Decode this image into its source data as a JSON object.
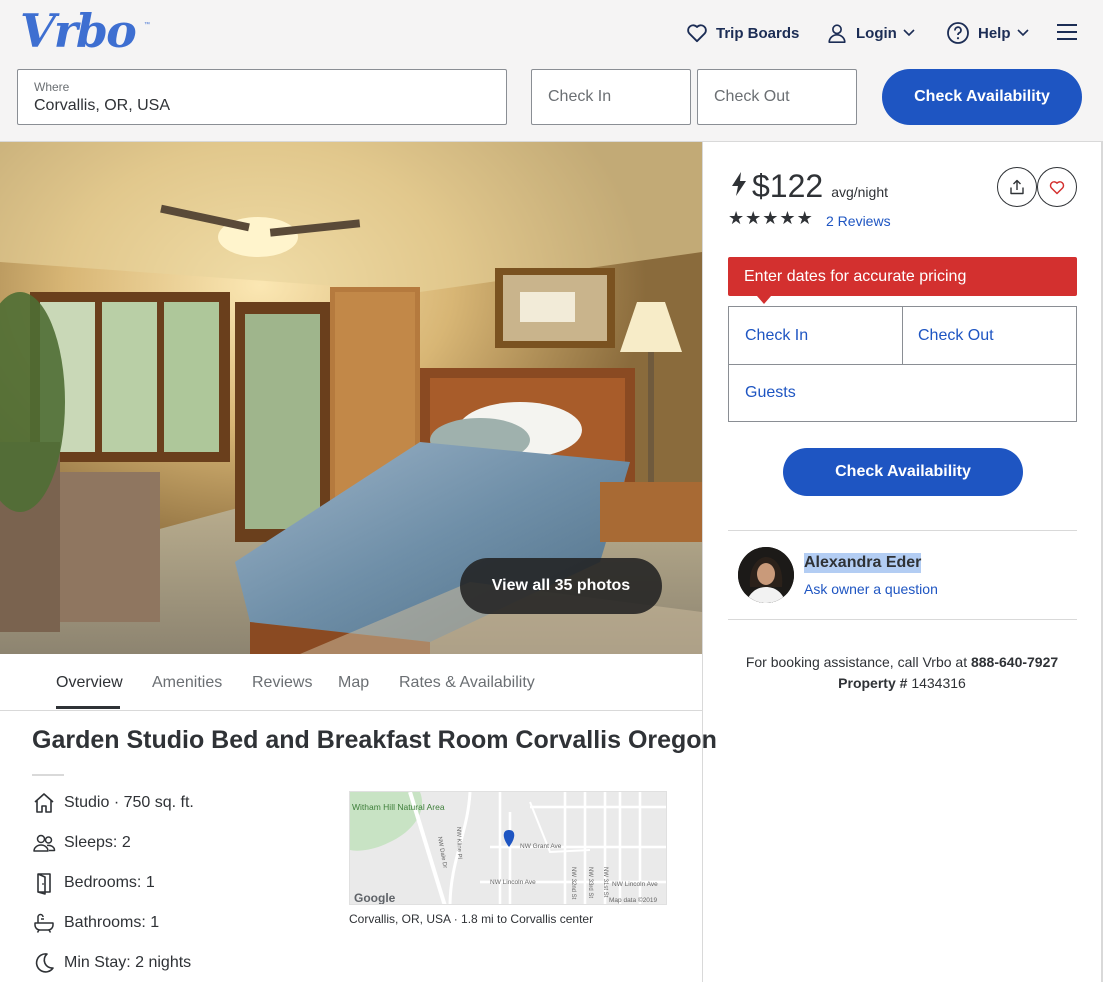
{
  "header": {
    "logo": "Vrbo",
    "nav": {
      "trip_boards": "Trip Boards",
      "login": "Login",
      "help": "Help"
    },
    "search": {
      "where_label": "Where",
      "where_value": "Corvallis, OR, USA",
      "check_in_placeholder": "Check In",
      "check_out_placeholder": "Check Out",
      "submit_label": "Check Availability"
    }
  },
  "gallery": {
    "view_all_label": "View all 35 photos"
  },
  "tabs": [
    {
      "label": "Overview",
      "active": true
    },
    {
      "label": "Amenities",
      "active": false
    },
    {
      "label": "Reviews",
      "active": false
    },
    {
      "label": "Map",
      "active": false
    },
    {
      "label": "Rates & Availability",
      "active": false
    }
  ],
  "listing": {
    "title": "Garden Studio Bed and Breakfast Room Corvallis Oregon",
    "facts": [
      {
        "icon": "house-icon",
        "text": "Studio · 750 sq. ft."
      },
      {
        "icon": "people-icon",
        "text": "Sleeps: 2"
      },
      {
        "icon": "door-icon",
        "text": "Bedrooms: 1"
      },
      {
        "icon": "bathtub-icon",
        "text": "Bathrooms: 1"
      },
      {
        "icon": "moon-icon",
        "text": "Min Stay: 2 nights"
      }
    ],
    "map": {
      "labels": {
        "park": "Witham Hill Natural Area",
        "grant": "NW Grant Ave",
        "lincoln": "NW Lincoln Ave",
        "lincoln2": "NW Lincoln Ave",
        "dale": "NW Dale Dr",
        "kline": "NW Kline Pl",
        "s32": "NW 32nd St",
        "s33": "NW 33rd St",
        "s31": "NW 31st St",
        "google": "Google",
        "map_data": "Map data ©2019"
      },
      "caption_place": "Corvallis, OR, USA",
      "caption_distance": "1.8 mi to Corvallis center"
    }
  },
  "booking": {
    "price": "$122",
    "price_unit": "avg/night",
    "rating": 5,
    "stars": [
      "★",
      "★",
      "★",
      "★",
      "★"
    ],
    "reviews_label": "2 Reviews",
    "alert": "Enter dates for accurate pricing",
    "check_in": "Check In",
    "check_out": "Check Out",
    "guests": "Guests",
    "submit_label": "Check Availability",
    "owner_name": "Alexandra Eder",
    "ask_owner": "Ask owner a question",
    "assist_text": "For booking assistance, call Vrbo at",
    "assist_phone": "888-640-7927",
    "property_label": "Property #",
    "property_number": "1434316"
  },
  "colors": {
    "brand": "#3e6fd1",
    "primary_button": "#1e55c2",
    "alert": "#d3302f",
    "nav_text": "#1c2d55"
  }
}
